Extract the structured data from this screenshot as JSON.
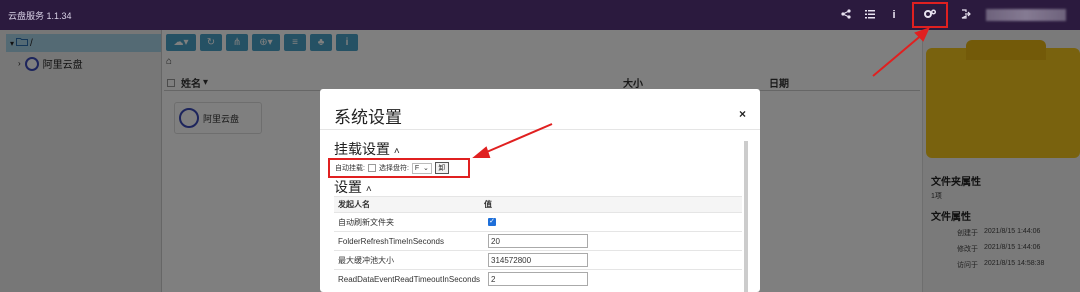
{
  "app": {
    "title": "云盘服务 1.1.34"
  },
  "topbar": {
    "share_icon": "share-icon",
    "list_icon": "list-icon",
    "info_icon": "info-icon",
    "settings_icon": "gears-icon",
    "logout_icon": "logout-icon"
  },
  "tree": {
    "root_label": "/",
    "items": [
      {
        "label": "阿里云盘"
      }
    ]
  },
  "toolbar": {
    "buttons": [
      "cloud-icon",
      "refresh-icon",
      "share-icon",
      "zoom-icon",
      "list-icon",
      "tree-icon",
      "info-icon"
    ]
  },
  "breadcrumb": {
    "home": "home-icon"
  },
  "filelist": {
    "col_name": "姓名",
    "col_size": "大小",
    "col_date": "日期",
    "items": [
      {
        "name": "阿里云盘"
      }
    ]
  },
  "right_panel": {
    "folder_props_title": "文件夹属性",
    "folder_count": "1项",
    "file_props_title": "文件属性",
    "props": [
      {
        "key": "创建于",
        "value": "2021/8/15 1:44:06"
      },
      {
        "key": "修改于",
        "value": "2021/8/15 1:44:06"
      },
      {
        "key": "访问于",
        "value": "2021/8/15 14:58:38"
      }
    ]
  },
  "modal": {
    "title": "系统设置",
    "close": "×",
    "mount_section_title": "挂载设置",
    "auto_mount_label": "自动挂载:",
    "select_drive_label": "选择盘符:",
    "drive_value": "F",
    "mount_button": "卸",
    "settings_section_title": "设置",
    "table": {
      "col_name": "发起人名",
      "col_value": "值",
      "rows": [
        {
          "name": "自动刷新文件夹",
          "type": "checkbox",
          "value": "checked"
        },
        {
          "name": "FolderRefreshTimeInSeconds",
          "type": "input",
          "value": "20"
        },
        {
          "name": "最大缓冲池大小",
          "type": "input",
          "value": "314572800"
        },
        {
          "name": "ReadDataEventReadTimeoutInSeconds",
          "type": "input",
          "value": "2"
        }
      ]
    }
  },
  "colors": {
    "topbar": "#2b1a3e",
    "accent": "#4aa3c8",
    "annotation": "#e02020",
    "folder": "#f2c51c"
  }
}
